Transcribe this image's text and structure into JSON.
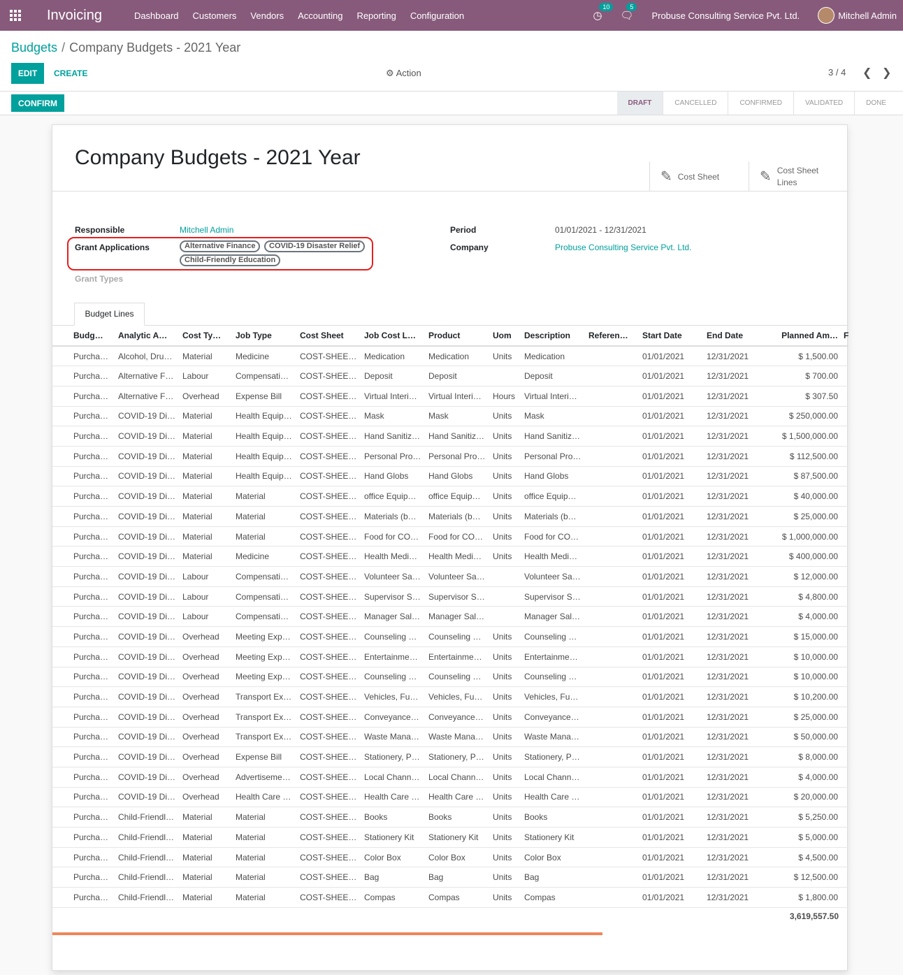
{
  "navbar": {
    "app_title": "Invoicing",
    "menu": [
      "Dashboard",
      "Customers",
      "Vendors",
      "Accounting",
      "Reporting",
      "Configuration"
    ],
    "activity_count": "10",
    "message_count": "5",
    "company": "Probuse Consulting Service Pvt. Ltd.",
    "user": "Mitchell Admin"
  },
  "breadcrumb": {
    "parent": "Budgets",
    "separator": "/",
    "current": "Company Budgets - 2021 Year"
  },
  "toolbar": {
    "edit": "EDIT",
    "create": "CREATE",
    "action": "Action",
    "pager": "3 / 4"
  },
  "status": {
    "confirm": "CONFIRM",
    "stages": [
      "DRAFT",
      "CANCELLED",
      "CONFIRMED",
      "VALIDATED",
      "DONE"
    ],
    "active": "DRAFT"
  },
  "form": {
    "title": "Company Budgets - 2021 Year",
    "smart_buttons": [
      "Cost Sheet",
      "Cost Sheet",
      "Lines"
    ],
    "responsible_label": "Responsible",
    "responsible": "Mitchell Admin",
    "grant_applications_label": "Grant Applications",
    "grant_applications": [
      "Alternative Finance",
      "COVID-19 Disaster Relief",
      "Child-Friendly Education"
    ],
    "grant_types_label": "Grant Types",
    "period_label": "Period",
    "period": "01/01/2021 - 12/31/2021",
    "company_label": "Company",
    "company": "Probuse Consulting Service Pvt. Ltd."
  },
  "tab": "Budget Lines",
  "table": {
    "columns": [
      "Budg…",
      "Analytic A…",
      "Cost Ty…",
      "Job Type",
      "Cost Sheet",
      "Job Cost L…",
      "Product",
      "Uom",
      "Description",
      "Referen…",
      "Start Date",
      "End Date",
      "Planned Am…",
      "F"
    ],
    "rows": [
      [
        "Purcha…",
        "Alcohol, Dru…",
        "Material",
        "Medicine",
        "COST-SHEET…",
        "Medication",
        "Medication",
        "Units",
        "Medication",
        "",
        "01/01/2021",
        "12/31/2021",
        "$ 1,500.00",
        ""
      ],
      [
        "Purcha…",
        "Alternative F…",
        "Labour",
        "Compensati…",
        "COST-SHEET…",
        "Deposit",
        "Deposit",
        "",
        "Deposit",
        "",
        "01/01/2021",
        "12/31/2021",
        "$ 700.00",
        ""
      ],
      [
        "Purcha…",
        "Alternative F…",
        "Overhead",
        "Expense Bill",
        "COST-SHEET…",
        "Virtual Interi…",
        "Virtual Interi…",
        "Hours",
        "Virtual Interi…",
        "",
        "01/01/2021",
        "12/31/2021",
        "$ 307.50",
        ""
      ],
      [
        "Purcha…",
        "COVID-19 Di…",
        "Material",
        "Health Equip…",
        "COST-SHEET…",
        "Mask",
        "Mask",
        "Units",
        "Mask",
        "",
        "01/01/2021",
        "12/31/2021",
        "$ 250,000.00",
        ""
      ],
      [
        "Purcha…",
        "COVID-19 Di…",
        "Material",
        "Health Equip…",
        "COST-SHEET…",
        "Hand Sanitiz…",
        "Hand Sanitiz…",
        "Units",
        "Hand Sanitiz…",
        "",
        "01/01/2021",
        "12/31/2021",
        "$ 1,500,000.00",
        ""
      ],
      [
        "Purcha…",
        "COVID-19 Di…",
        "Material",
        "Health Equip…",
        "COST-SHEET…",
        "Personal Pro…",
        "Personal Pro…",
        "Units",
        "Personal Pro…",
        "",
        "01/01/2021",
        "12/31/2021",
        "$ 112,500.00",
        ""
      ],
      [
        "Purcha…",
        "COVID-19 Di…",
        "Material",
        "Health Equip…",
        "COST-SHEET…",
        "Hand Globs",
        "Hand Globs",
        "Units",
        "Hand Globs",
        "",
        "01/01/2021",
        "12/31/2021",
        "$ 87,500.00",
        ""
      ],
      [
        "Purcha…",
        "COVID-19 Di…",
        "Material",
        "Material",
        "COST-SHEET…",
        "office Equip…",
        "office Equip…",
        "Units",
        "office Equip…",
        "",
        "01/01/2021",
        "12/31/2021",
        "$ 40,000.00",
        ""
      ],
      [
        "Purcha…",
        "COVID-19 Di…",
        "Material",
        "Material",
        "COST-SHEET…",
        "Materials (b…",
        "Materials (b…",
        "Units",
        "Materials (b…",
        "",
        "01/01/2021",
        "12/31/2021",
        "$ 25,000.00",
        ""
      ],
      [
        "Purcha…",
        "COVID-19 Di…",
        "Material",
        "Material",
        "COST-SHEET…",
        "Food for CO…",
        "Food for CO…",
        "Units",
        "Food for CO…",
        "",
        "01/01/2021",
        "12/31/2021",
        "$ 1,000,000.00",
        ""
      ],
      [
        "Purcha…",
        "COVID-19 Di…",
        "Material",
        "Medicine",
        "COST-SHEET…",
        "Health Medi…",
        "Health Medi…",
        "Units",
        "Health Medi…",
        "",
        "01/01/2021",
        "12/31/2021",
        "$ 400,000.00",
        ""
      ],
      [
        "Purcha…",
        "COVID-19 Di…",
        "Labour",
        "Compensati…",
        "COST-SHEET…",
        "Volunteer Sa…",
        "Volunteer Sa…",
        "",
        "Volunteer Sa…",
        "",
        "01/01/2021",
        "12/31/2021",
        "$ 12,000.00",
        ""
      ],
      [
        "Purcha…",
        "COVID-19 Di…",
        "Labour",
        "Compensati…",
        "COST-SHEET…",
        "Supervisor S…",
        "Supervisor S…",
        "",
        "Supervisor S…",
        "",
        "01/01/2021",
        "12/31/2021",
        "$ 4,800.00",
        ""
      ],
      [
        "Purcha…",
        "COVID-19 Di…",
        "Labour",
        "Compensati…",
        "COST-SHEET…",
        "Manager Sal…",
        "Manager Sal…",
        "",
        "Manager Sal…",
        "",
        "01/01/2021",
        "12/31/2021",
        "$ 4,000.00",
        ""
      ],
      [
        "Purcha…",
        "COVID-19 Di…",
        "Overhead",
        "Meeting Exp…",
        "COST-SHEET…",
        "Counseling …",
        "Counseling …",
        "Units",
        "Counseling …",
        "",
        "01/01/2021",
        "12/31/2021",
        "$ 15,000.00",
        ""
      ],
      [
        "Purcha…",
        "COVID-19 Di…",
        "Overhead",
        "Meeting Exp…",
        "COST-SHEET…",
        "Entertainme…",
        "Entertainme…",
        "Units",
        "Entertainme…",
        "",
        "01/01/2021",
        "12/31/2021",
        "$ 10,000.00",
        ""
      ],
      [
        "Purcha…",
        "COVID-19 Di…",
        "Overhead",
        "Meeting Exp…",
        "COST-SHEET…",
        "Counseling …",
        "Counseling …",
        "Units",
        "Counseling …",
        "",
        "01/01/2021",
        "12/31/2021",
        "$ 10,000.00",
        ""
      ],
      [
        "Purcha…",
        "COVID-19 Di…",
        "Overhead",
        "Transport Ex…",
        "COST-SHEET…",
        "Vehicles, Fu…",
        "Vehicles, Fu…",
        "Units",
        "Vehicles, Fu…",
        "",
        "01/01/2021",
        "12/31/2021",
        "$ 10,200.00",
        ""
      ],
      [
        "Purcha…",
        "COVID-19 Di…",
        "Overhead",
        "Transport Ex…",
        "COST-SHEET…",
        "Conveyance…",
        "Conveyance…",
        "Units",
        "Conveyance…",
        "",
        "01/01/2021",
        "12/31/2021",
        "$ 25,000.00",
        ""
      ],
      [
        "Purcha…",
        "COVID-19 Di…",
        "Overhead",
        "Transport Ex…",
        "COST-SHEET…",
        "Waste Mana…",
        "Waste Mana…",
        "Units",
        "Waste Mana…",
        "",
        "01/01/2021",
        "12/31/2021",
        "$ 50,000.00",
        ""
      ],
      [
        "Purcha…",
        "COVID-19 Di…",
        "Overhead",
        "Expense Bill",
        "COST-SHEET…",
        "Stationery, P…",
        "Stationery, P…",
        "Units",
        "Stationery, P…",
        "",
        "01/01/2021",
        "12/31/2021",
        "$ 8,000.00",
        ""
      ],
      [
        "Purcha…",
        "COVID-19 Di…",
        "Overhead",
        "Advertiseme…",
        "COST-SHEET…",
        "Local Chann…",
        "Local Chann…",
        "Units",
        "Local Chann…",
        "",
        "01/01/2021",
        "12/31/2021",
        "$ 4,000.00",
        ""
      ],
      [
        "Purcha…",
        "COVID-19 Di…",
        "Overhead",
        "Health Care …",
        "COST-SHEET…",
        "Health Care …",
        "Health Care …",
        "Units",
        "Health Care …",
        "",
        "01/01/2021",
        "12/31/2021",
        "$ 20,000.00",
        ""
      ],
      [
        "Purcha…",
        "Child-Friendl…",
        "Material",
        "Material",
        "COST-SHEET…",
        "Books",
        "Books",
        "Units",
        "Books",
        "",
        "01/01/2021",
        "12/31/2021",
        "$ 5,250.00",
        ""
      ],
      [
        "Purcha…",
        "Child-Friendl…",
        "Material",
        "Material",
        "COST-SHEET…",
        "Stationery Kit",
        "Stationery Kit",
        "Units",
        "Stationery Kit",
        "",
        "01/01/2021",
        "12/31/2021",
        "$ 5,000.00",
        ""
      ],
      [
        "Purcha…",
        "Child-Friendl…",
        "Material",
        "Material",
        "COST-SHEET…",
        "Color Box",
        "Color Box",
        "Units",
        "Color Box",
        "",
        "01/01/2021",
        "12/31/2021",
        "$ 4,500.00",
        ""
      ],
      [
        "Purcha…",
        "Child-Friendl…",
        "Material",
        "Material",
        "COST-SHEET…",
        "Bag",
        "Bag",
        "Units",
        "Bag",
        "",
        "01/01/2021",
        "12/31/2021",
        "$ 12,500.00",
        ""
      ],
      [
        "Purcha…",
        "Child-Friendl…",
        "Material",
        "Material",
        "COST-SHEET…",
        "Compas",
        "Compas",
        "Units",
        "Compas",
        "",
        "01/01/2021",
        "12/31/2021",
        "$ 1,800.00",
        ""
      ]
    ],
    "total": "3,619,557.50"
  },
  "colors": {
    "brand": "#875a7b",
    "accent": "#00a09d",
    "highlight": "#e51f1f"
  }
}
